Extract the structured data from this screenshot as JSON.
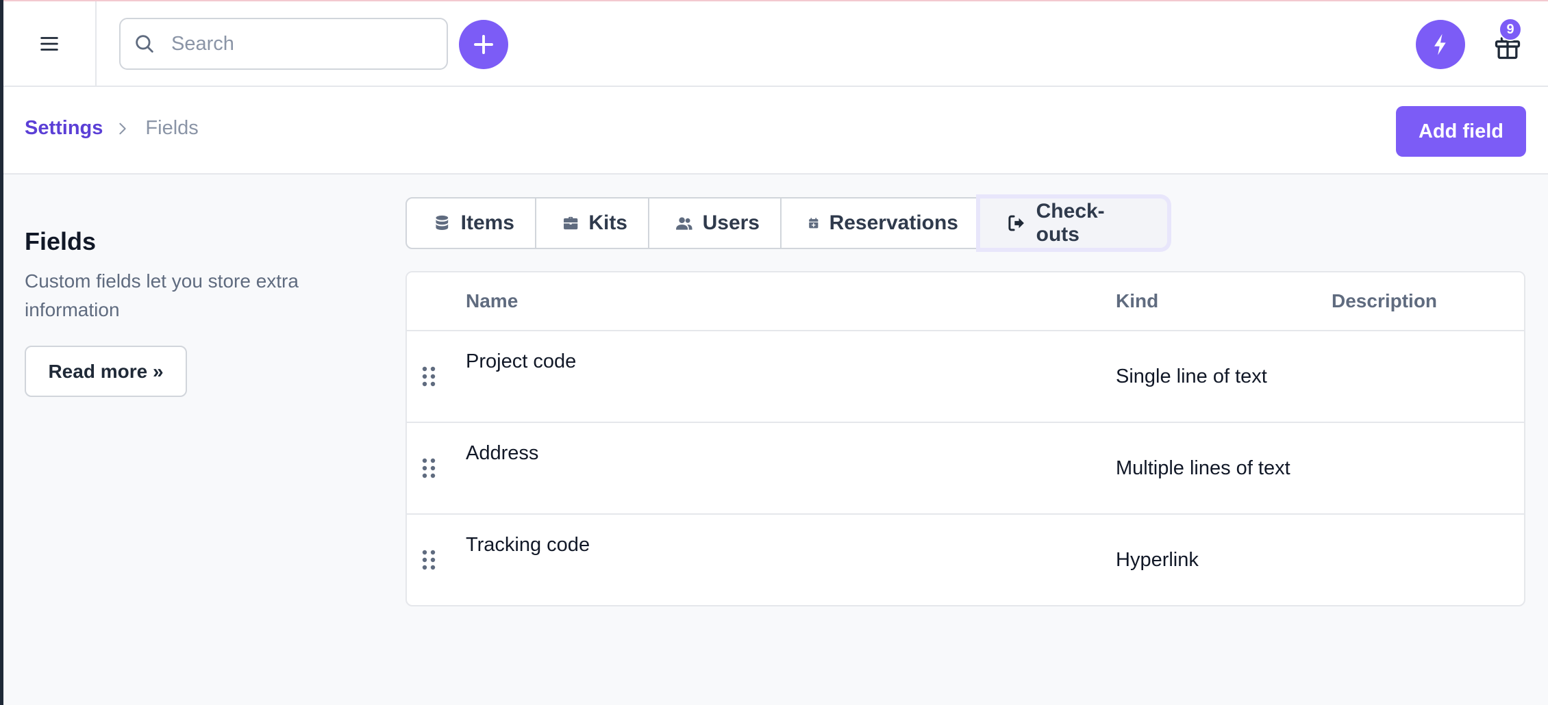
{
  "search": {
    "placeholder": "Search"
  },
  "notifications": {
    "gift_count": "9"
  },
  "breadcrumb": {
    "root": "Settings",
    "current": "Fields"
  },
  "header": {
    "add_field_label": "Add field"
  },
  "side": {
    "title": "Fields",
    "description": "Custom fields let you store extra information",
    "read_more_label": "Read more »"
  },
  "tabs": [
    {
      "label": "Items",
      "icon": "database-icon"
    },
    {
      "label": "Kits",
      "icon": "briefcase-icon"
    },
    {
      "label": "Users",
      "icon": "users-icon"
    },
    {
      "label": "Reservations",
      "icon": "calendar-plus-icon"
    },
    {
      "label": "Check-outs",
      "icon": "sign-out-icon",
      "active": true
    }
  ],
  "table": {
    "headers": {
      "name": "Name",
      "kind": "Kind",
      "description": "Description"
    },
    "rows": [
      {
        "name": "Project code",
        "kind": "Single line of text",
        "description": ""
      },
      {
        "name": "Address",
        "kind": "Multiple lines of text",
        "description": ""
      },
      {
        "name": "Tracking code",
        "kind": "Hyperlink",
        "description": ""
      }
    ]
  },
  "colors": {
    "accent": "#7c5cf6",
    "link": "#5b3fd6",
    "muted_text": "#5f6b7f",
    "border": "#e5e7eb"
  }
}
